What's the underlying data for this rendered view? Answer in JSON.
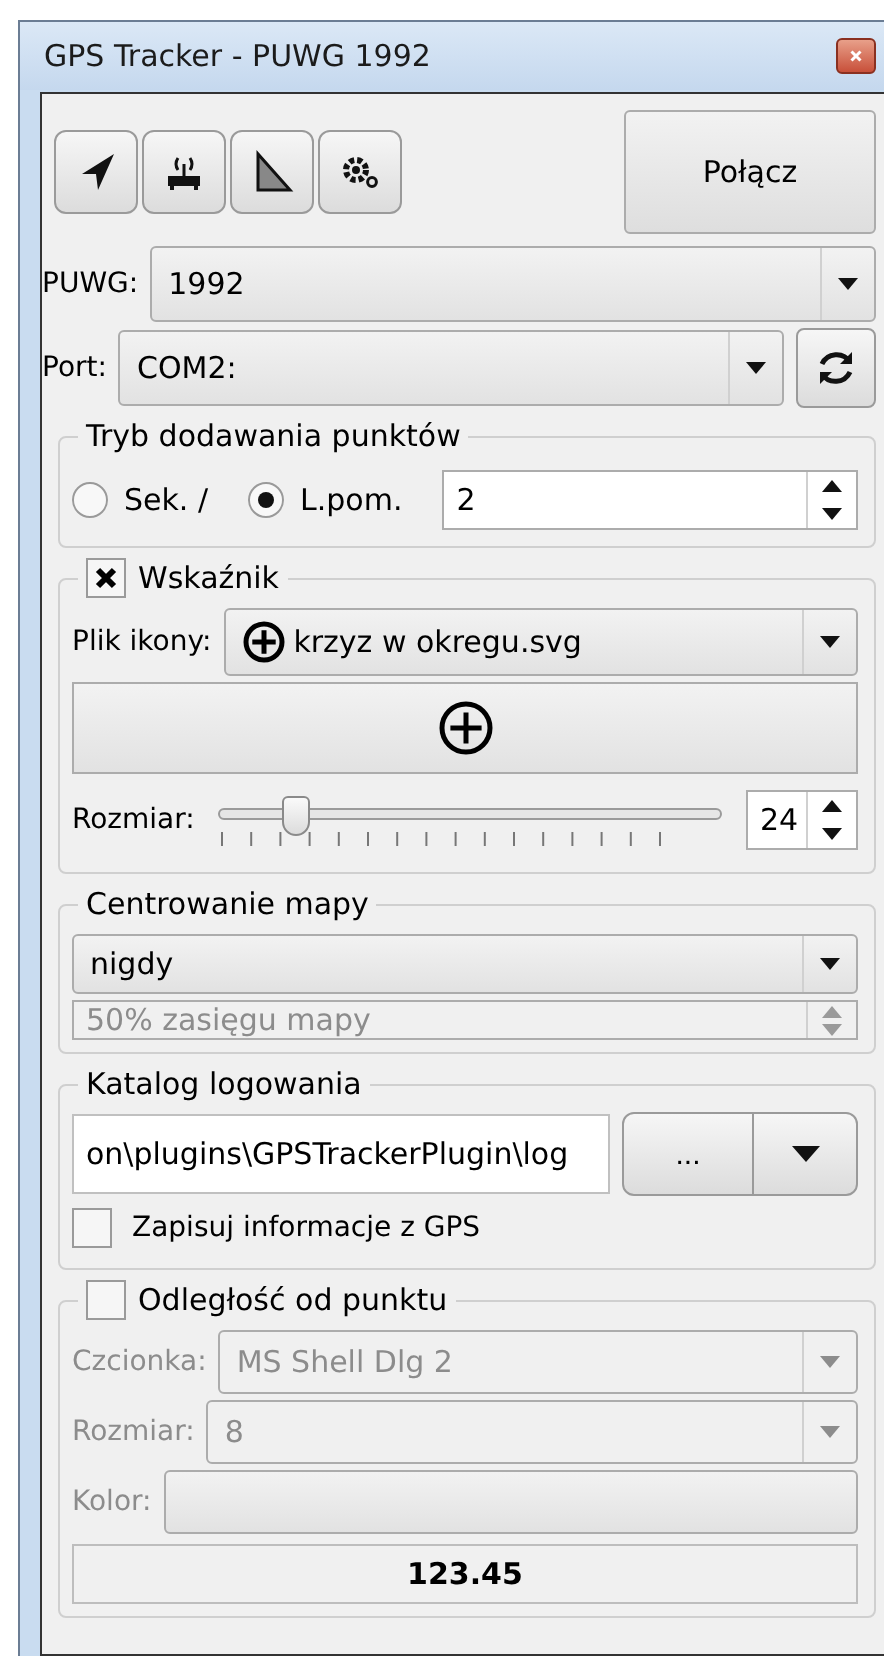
{
  "window": {
    "title": "GPS Tracker - PUWG 1992"
  },
  "connect_button": "Połącz",
  "puwg": {
    "label": "PUWG:",
    "value": "1992"
  },
  "port": {
    "label": "Port:",
    "value": "COM2:"
  },
  "point_mode": {
    "title": "Tryb dodawania punktów",
    "options": [
      {
        "label": "Sek. /",
        "selected": false
      },
      {
        "label": "L.pom.",
        "selected": true
      }
    ],
    "value": "2"
  },
  "indicator": {
    "title": "Wskaźnik",
    "checked": true,
    "icon_file_label": "Plik ikony:",
    "icon_file": "krzyz w okregu.svg",
    "size_label": "Rozmiar:",
    "size_slider": {
      "level": 0.15
    },
    "size_value": "24"
  },
  "centering": {
    "title": "Centrowanie mapy",
    "mode": "nigdy",
    "range": {
      "value": "50% zasięgu mapy",
      "disabled": true
    }
  },
  "log": {
    "title": "Katalog logowania",
    "path": "on\\plugins\\GPSTrackerPlugin\\log",
    "browse_button": "...",
    "save_gps": {
      "label": "Zapisuj informacje z GPS",
      "checked": false
    }
  },
  "distance": {
    "title": "Odległość od punktu",
    "checked": false,
    "font_label": "Czcionka:",
    "font": "MS Shell Dlg 2",
    "size_label": "Rozmiar:",
    "size": "8",
    "color_label": "Kolor:",
    "value": "123.45"
  }
}
